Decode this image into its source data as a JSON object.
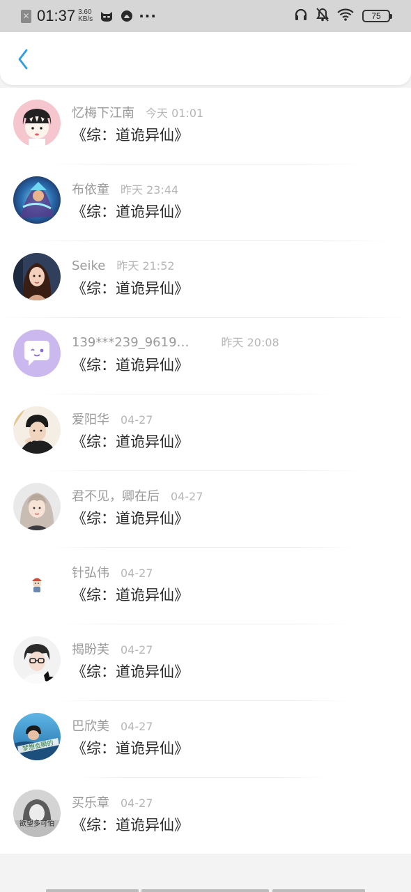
{
  "status_bar": {
    "time": "01:37",
    "speed_value": "3.60",
    "speed_unit": "KB/s",
    "dots": "···",
    "battery": "75"
  },
  "header": {
    "back_icon": "chevron-left-icon",
    "accent_color": "#2e9de2"
  },
  "items": [
    {
      "name": "忆梅下江南",
      "time": "今天 01:01",
      "title": "《综：道诡异仙》"
    },
    {
      "name": "布依童",
      "time": "昨天 23:44",
      "title": "《综：道诡异仙》"
    },
    {
      "name": "Seike",
      "time": "昨天 21:52",
      "title": "《综：道诡异仙》"
    },
    {
      "name": "139***239_9619…",
      "time": "昨天 20:08",
      "title": "《综：道诡异仙》"
    },
    {
      "name": "爱阳华",
      "time": "04-27",
      "title": "《综：道诡异仙》"
    },
    {
      "name": "君不见，卿在后",
      "time": "04-27",
      "title": "《综：道诡异仙》"
    },
    {
      "name": "针弘伟",
      "time": "04-27",
      "title": "《综：道诡异仙》"
    },
    {
      "name": "揭盼芙",
      "time": "04-27",
      "title": "《综：道诡异仙》"
    },
    {
      "name": "巴欣美",
      "time": "04-27",
      "title": "《综：道诡异仙》"
    },
    {
      "name": "买乐章",
      "time": "04-27",
      "title": "《综：道诡异仙》"
    }
  ],
  "avatar_texts": {
    "item_9": "梦想会瞬的",
    "item_10": "欲望多可怕"
  }
}
